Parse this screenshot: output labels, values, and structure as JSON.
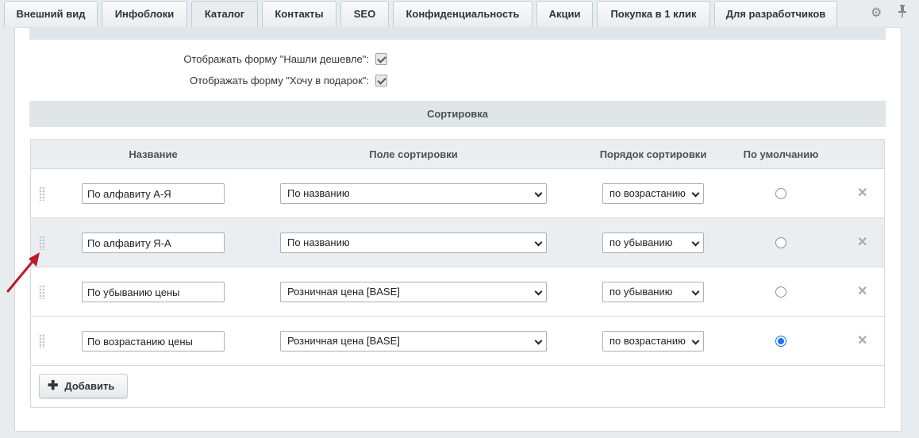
{
  "tabs": [
    {
      "label": "Внешний вид"
    },
    {
      "label": "Инфоблоки"
    },
    {
      "label": "Каталог"
    },
    {
      "label": "Контакты"
    },
    {
      "label": "SEO"
    },
    {
      "label": "Конфиденциальность"
    },
    {
      "label": "Акции"
    },
    {
      "label": "Покупка в 1 клик"
    },
    {
      "label": "Для разработчиков"
    }
  ],
  "active_tab": "Каталог",
  "tools": {
    "settings_icon": "gear-icon",
    "pin_icon": "pin-icon"
  },
  "options": [
    {
      "label": "Отображать форму \"Нашли дешевле\":",
      "checked": true
    },
    {
      "label": "Отображать форму \"Хочу в подарок\":",
      "checked": true
    }
  ],
  "section_title": "Сортировка",
  "columns": {
    "name": "Название",
    "field": "Поле сортировки",
    "order": "Порядок сортировки",
    "default": "По умолчанию"
  },
  "rows": [
    {
      "name": "По алфавиту А-Я",
      "field": "По названию",
      "order": "по возрастанию",
      "default": false
    },
    {
      "name": "По алфавиту Я-А",
      "field": "По названию",
      "order": "по убыванию",
      "default": false
    },
    {
      "name": "По убыванию цены",
      "field": "Розничная цена [BASE]",
      "order": "по убыванию",
      "default": false
    },
    {
      "name": "По возрастанию цены",
      "field": "Розничная цена [BASE]",
      "order": "по возрастанию",
      "default": true
    }
  ],
  "add_button": "Добавить",
  "colors": {
    "accent_radio": "#1a73e8",
    "annotation_arrow": "#c0182a",
    "header_bg": "#dfe5e8"
  }
}
